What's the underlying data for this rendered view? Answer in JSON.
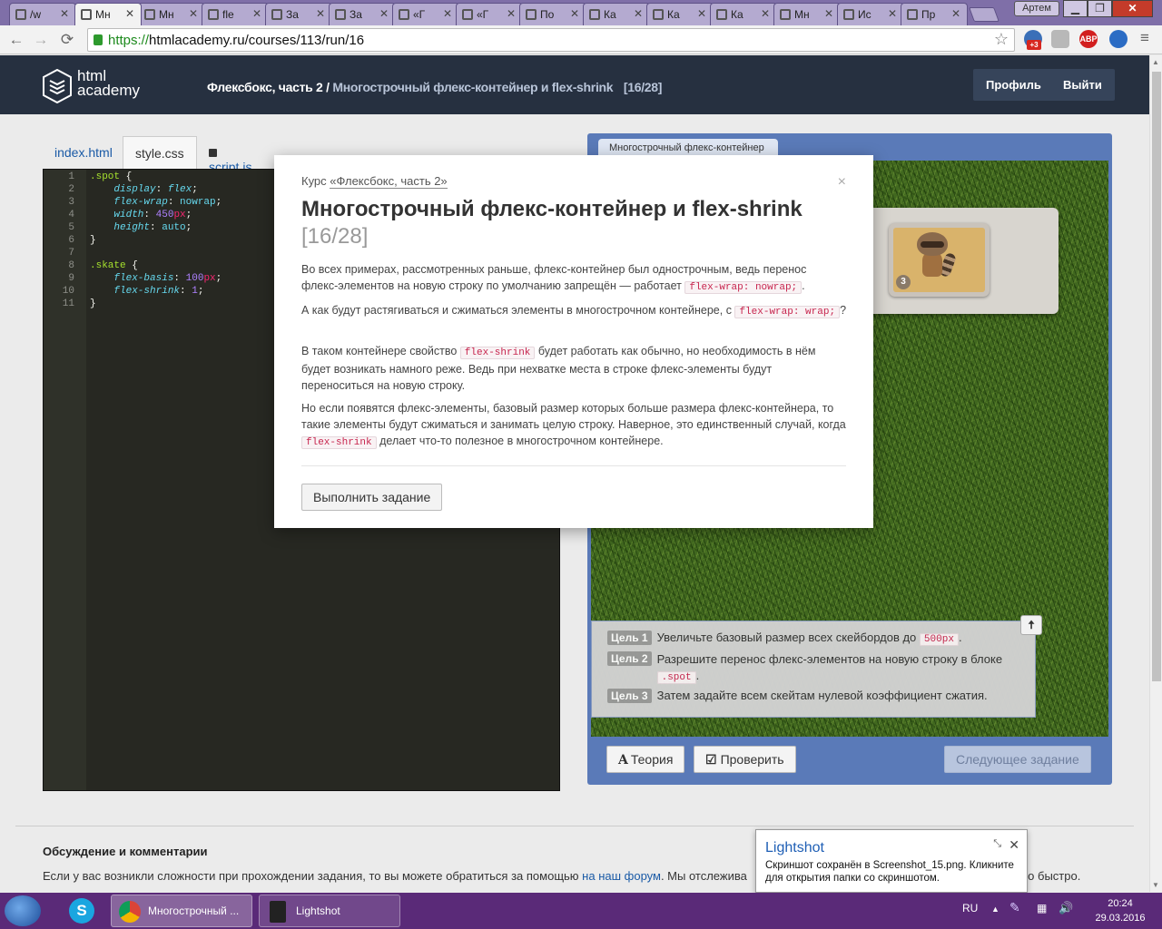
{
  "browser": {
    "tabs": [
      {
        "label": "/w",
        "active": false
      },
      {
        "label": "Мн",
        "active": true
      },
      {
        "label": "Мн",
        "active": false
      },
      {
        "label": "fle",
        "active": false
      },
      {
        "label": "За",
        "active": false
      },
      {
        "label": "За",
        "active": false
      },
      {
        "label": "«Г",
        "active": false
      },
      {
        "label": "«Г",
        "active": false
      },
      {
        "label": "По",
        "active": false
      },
      {
        "label": "Ка",
        "active": false
      },
      {
        "label": "Ка",
        "active": false
      },
      {
        "label": "Ка",
        "active": false
      },
      {
        "label": "Мн",
        "active": false
      },
      {
        "label": "Ис",
        "active": false
      },
      {
        "label": "Пр",
        "active": false
      }
    ],
    "user": "Артем",
    "url_scheme": "https://",
    "url_rest": "htmlacademy.ru/courses/113/run/16",
    "extension_badge": "+3",
    "abp_label": "ABP",
    "window_minimize": "▁",
    "window_restore": "❐",
    "window_close": "✕"
  },
  "header": {
    "logo_line1": "html",
    "logo_line2": "academy",
    "course": "Флексбокс, часть 2",
    "separator": " / ",
    "lesson": "Многострочный флекс-контейнер и flex-shrink",
    "step": "[16/28]",
    "profile_label": "Профиль",
    "logout_label": "Выйти"
  },
  "editor": {
    "tabs": [
      "index.html",
      "style.css",
      "script.js"
    ],
    "active_tab": "style.css",
    "line_numbers": [
      "1",
      "2",
      "3",
      "4",
      "5",
      "6",
      "7",
      "8",
      "9",
      "10",
      "11"
    ]
  },
  "preview": {
    "tab_label": "Многострочный флекс-контейнер",
    "skate_number": "3",
    "goals": [
      {
        "badge": "Цель 1",
        "text": "Увеличьте базовый размер всех скейбордов до",
        "code": "500px",
        "after": "."
      },
      {
        "badge": "Цель 2",
        "text": "Разрешите перенос флекс-элементов на новую строку в блоке",
        "code": ".spot",
        "after": "."
      },
      {
        "badge": "Цель 3",
        "text": "Затем задайте всем скейтам нулевой коэффициент сжатия.",
        "code": "",
        "after": ""
      }
    ],
    "goals_toggle": "🠅",
    "theory_label": "Теория",
    "check_label": "Проверить",
    "next_label": "Следующее задание"
  },
  "modal": {
    "course_prefix": "Курс",
    "course_link": "«Флексбокс, часть 2»",
    "close": "×",
    "title": "Многострочный флекс-контейнер и flex-shrink",
    "step": "[16/28]",
    "p1": "Во всех примерах, рассмотренных раньше, флекс-контейнер был однострочным, ведь перенос флекс-элементов на новую строку по умолчанию запрещён — работает",
    "p1_code": "flex-wrap: nowrap;",
    "p1_after": ".",
    "p2": "А как будут растягиваться и сжиматься элементы в многострочном контейнере, с",
    "p2_code": "flex-wrap: wrap;",
    "p2_after": "?",
    "p3_before": "В таком контейнере свойство",
    "p3_code": "flex-shrink",
    "p3_after": "будет работать как обычно, но необходимость в нём будет возникать намного реже. Ведь при нехватке места в строке флекс-элементы будут переноситься на новую строку.",
    "p4_before": "Но если появятся флекс-элементы, базовый размер которых больше размера флекс-контейнера, то такие элементы будут сжиматься и занимать целую строку. Наверное, это единственный случай, когда",
    "p4_code": "flex-shrink",
    "p4_after": "делает что-то полезное в многострочном контейнере.",
    "button": "Выполнить задание"
  },
  "discussion": {
    "title": "Обсуждение и комментарии",
    "text_before": "Если у вас возникли сложности при прохождении задания, то вы можете обратиться за помощью",
    "link": "на наш форум",
    "text_after": ". Мы отслежива",
    "tail": "но быстро."
  },
  "toast": {
    "title": "Lightshot",
    "body": "Скриншот сохранён в Screenshot_15.png. Кликните для открытия папки со скриншотом.",
    "close": "✕",
    "pin": "⤡"
  },
  "taskbar": {
    "chrome_label": "Многострочный ...",
    "lightshot_label": "Lightshot",
    "lang": "RU",
    "time": "20:24",
    "date": "29.03.2016"
  }
}
